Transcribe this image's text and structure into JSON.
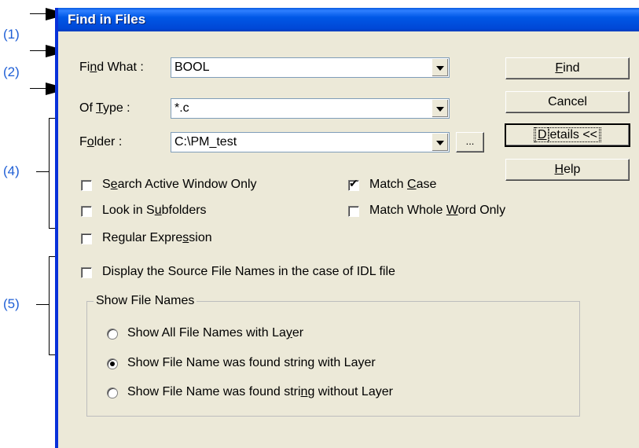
{
  "callouts": [
    "(1)",
    "(2)",
    "(4)",
    "(5)"
  ],
  "window": {
    "title": "Find in Files",
    "close_label": "✕"
  },
  "fields": {
    "find_what": {
      "label_prefix": "Fi",
      "label_ul": "n",
      "label_suffix": "d What :",
      "value": "BOOL"
    },
    "of_type": {
      "label_prefix": "Of ",
      "label_ul": "T",
      "label_suffix": "ype :",
      "value": "*.c"
    },
    "folder": {
      "label_prefix": "F",
      "label_ul": "o",
      "label_suffix": "lder :",
      "value": "C:\\PM_test"
    },
    "browse_label": "..."
  },
  "buttons": {
    "find": {
      "ul": "F",
      "rest": "ind"
    },
    "cancel": "Cancel",
    "details": {
      "ul": "D",
      "rest": "etails <<"
    },
    "help": {
      "ul": "H",
      "rest": "elp"
    }
  },
  "options": {
    "search_active": {
      "a": "S",
      "ul": "e",
      "b": "arch Active Window Only",
      "checked": false
    },
    "match_case": {
      "a": "Match ",
      "ul": "C",
      "b": "ase",
      "checked": true
    },
    "subfolders": {
      "a": "Look in S",
      "ul": "u",
      "b": "bfolders",
      "checked": false
    },
    "whole_word": {
      "a": "Match Whole ",
      "ul": "W",
      "b": "ord Only",
      "checked": false
    },
    "regex": {
      "a": "Regular Expre",
      "ul": "s",
      "b": "sion",
      "checked": false
    },
    "idl": {
      "text": "Display the Source File Names in the case of IDL file",
      "checked": false
    }
  },
  "show_file_names": {
    "legend": "Show File Names",
    "radios": [
      {
        "a": "Show All File Names with La",
        "ul": "y",
        "b": "er",
        "selected": false
      },
      {
        "a": "Show File Name was found string with Layer",
        "ul": "",
        "b": "",
        "selected": true
      },
      {
        "a": "Show File Name was found stri",
        "ul": "n",
        "b": "g without Layer",
        "selected": false
      }
    ]
  }
}
